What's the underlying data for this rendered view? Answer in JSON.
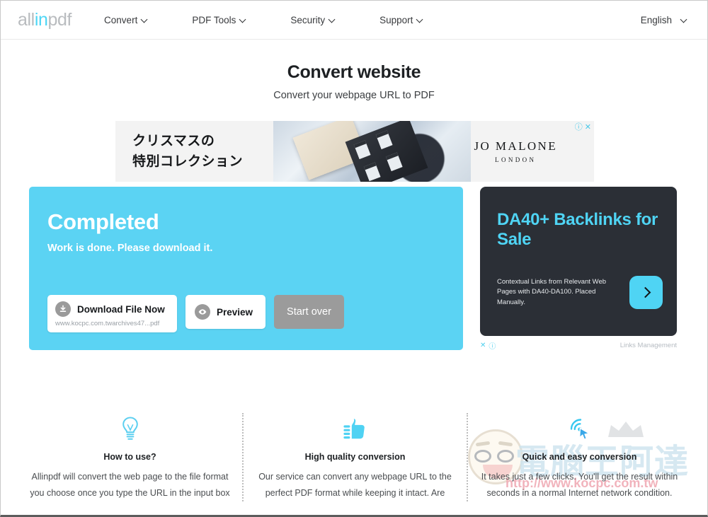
{
  "brand": {
    "logo_prefix": "all",
    "logo_highlight": "in",
    "logo_suffix": "pdf",
    "accent": "#4ed6f5"
  },
  "header": {
    "nav": [
      {
        "label": "Convert",
        "icon": "chevron-down-icon"
      },
      {
        "label": "PDF Tools",
        "icon": "chevron-down-icon"
      },
      {
        "label": "Security",
        "icon": "chevron-down-icon"
      },
      {
        "label": "Support",
        "icon": "chevron-down-icon"
      }
    ],
    "language": {
      "label": "English",
      "icon": "chevron-down-icon"
    }
  },
  "hero": {
    "title": "Convert website",
    "subtitle": "Convert your webpage URL to PDF"
  },
  "top_ad": {
    "jp_line1": "クリスマスの",
    "jp_line2": "特別コレクション",
    "brand_line1": "JO MALONE",
    "brand_line2": "LONDON",
    "info_icon": "info-icon",
    "close_icon": "close-icon",
    "info_glyph": "ⓘ",
    "close_glyph": "✕"
  },
  "completed": {
    "title": "Completed",
    "subtitle": "Work is done. Please download it.",
    "bg_color": "#5bd3f3",
    "download": {
      "label": "Download File Now",
      "filename": "www.kocpc.com.twarchives47...pdf",
      "icon": "download-circle-icon"
    },
    "preview": {
      "label": "Preview",
      "icon": "eye-circle-icon"
    },
    "start_over": {
      "label": "Start over",
      "color": "#9b9b9b"
    }
  },
  "right_ad": {
    "title": "DA40+ Backlinks for Sale",
    "description": "Contextual Links from Relevant Web Pages with DA40-DA100. Placed Manually.",
    "arrow_icon": "chevron-right-icon",
    "close_glyph": "✕",
    "info_glyph": "ⓘ",
    "credit": "Links Management",
    "bg_color": "#2b2f36",
    "accent": "#4fd4f4"
  },
  "features": [
    {
      "icon": "lightbulb-icon",
      "heading": "How to use?",
      "body": "Allinpdf will convert the web page to the file format you choose once you type the URL in the input box"
    },
    {
      "icon": "thumbs-up-icon",
      "heading": "High quality conversion",
      "body": "Our service can convert any webpage URL to the perfect PDF format while keeping it intact. Are"
    },
    {
      "icon": "cursor-click-icon",
      "heading": "Quick and easy conversion",
      "body": "It takes just a few clicks. You'll get the result within seconds in a normal Internet network condition."
    }
  ],
  "watermark": {
    "chinese_text": "電腦王阿達",
    "url": "http://www.kocpc.com.tw",
    "face_icon": "mascot-face-icon",
    "crown_icon": "crown-icon"
  }
}
